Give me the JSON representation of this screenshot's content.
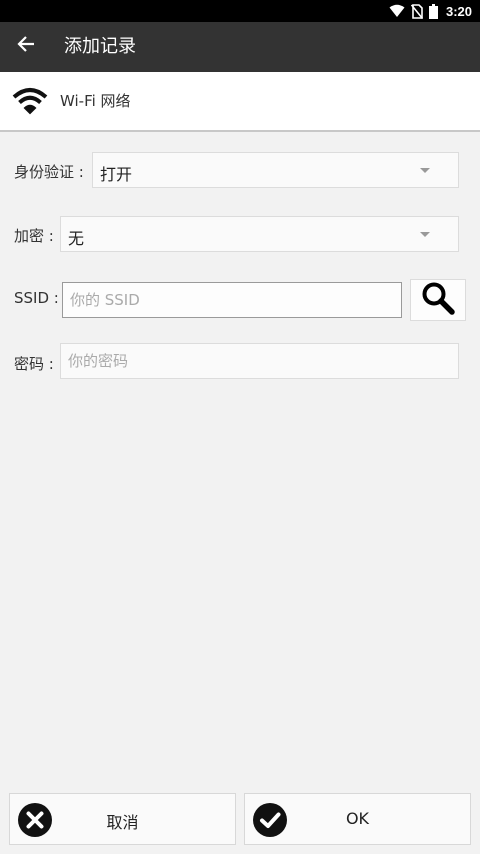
{
  "status_bar": {
    "time": "3:20",
    "icons": [
      "wifi-icon",
      "no-sim-icon",
      "battery-icon"
    ]
  },
  "app_bar": {
    "back_icon": "arrow-left-icon",
    "title": "添加记录"
  },
  "record_type": {
    "icon": "wifi-icon",
    "label": "Wi-Fi 网络"
  },
  "form": {
    "auth": {
      "label": "身份验证 :",
      "value": "打开"
    },
    "encryption": {
      "label": "加密 :",
      "value": "无"
    },
    "ssid": {
      "label": "SSID :",
      "value": "",
      "placeholder": "你的 SSID",
      "search_icon": "search-icon"
    },
    "password": {
      "label": "密码 :",
      "value": "",
      "placeholder": "你的密码"
    }
  },
  "actions": {
    "cancel": {
      "label": "取消",
      "icon": "close-circle-icon"
    },
    "ok": {
      "label": "OK",
      "icon": "check-circle-icon"
    }
  },
  "colors": {
    "app_bar": "#333333",
    "background": "#f2f2f2",
    "status_bar": "#000000"
  }
}
